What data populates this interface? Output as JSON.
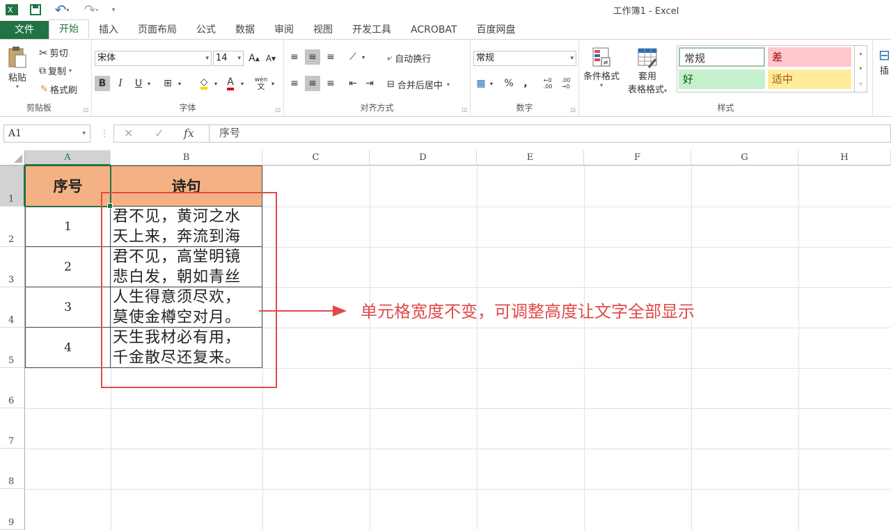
{
  "window": {
    "title": "工作簿1 - Excel"
  },
  "quick_access": {
    "undo": "↶",
    "redo": "↷"
  },
  "tabs": [
    "文件",
    "开始",
    "插入",
    "页面布局",
    "公式",
    "数据",
    "审阅",
    "视图",
    "开发工具",
    "ACROBAT",
    "百度网盘"
  ],
  "active_tab": "开始",
  "ribbon": {
    "clipboard": {
      "label": "剪贴板",
      "paste": "粘贴",
      "cut": "剪切",
      "copy": "复制",
      "format_painter": "格式刷"
    },
    "font": {
      "label": "字体",
      "name": "宋体",
      "size": "14",
      "bold": "B",
      "italic": "I",
      "underline": "U",
      "grow": "A",
      "shrink": "A",
      "phonetic": "wén"
    },
    "alignment": {
      "label": "对齐方式",
      "wrap_text": "自动换行",
      "merge_center": "合并后居中"
    },
    "number": {
      "label": "数字",
      "format": "常规",
      "percent": "%",
      "comma": ","
    },
    "styles": {
      "label": "样式",
      "conditional": "条件格式",
      "table_format_line1": "套用",
      "table_format_line2": "表格格式",
      "cells": [
        {
          "name": "常规",
          "bg": "#ffffff",
          "fg": "#333333"
        },
        {
          "name": "差",
          "bg": "#ffc7ce",
          "fg": "#9c0006"
        },
        {
          "name": "好",
          "bg": "#c6efce",
          "fg": "#006100"
        },
        {
          "name": "适中",
          "bg": "#ffeb9c",
          "fg": "#9c5700"
        }
      ]
    },
    "insert": "插"
  },
  "formula_bar": {
    "name_box": "A1",
    "cancel": "✕",
    "enter": "✓",
    "fx": "fx",
    "content": "序号"
  },
  "columns": [
    "A",
    "B",
    "C",
    "D",
    "E",
    "F",
    "G",
    "H"
  ],
  "rows": [
    "1",
    "2",
    "3",
    "4",
    "5",
    "6",
    "7",
    "8",
    "9"
  ],
  "sheet": {
    "header": {
      "a": "序号",
      "b": "诗句"
    },
    "data": [
      {
        "num": "1",
        "line1": "君不见，黄河之水",
        "line2": "天上来，奔流到海"
      },
      {
        "num": "2",
        "line1": "君不见，高堂明镜",
        "line2": "悲白发，朝如青丝"
      },
      {
        "num": "3",
        "line1": "人生得意须尽欢，",
        "line2": "莫使金樽空对月。"
      },
      {
        "num": "4",
        "line1": "天生我材必有用，",
        "line2": "千金散尽还复来。"
      }
    ]
  },
  "annotation": "单元格宽度不变，可调整高度让文字全部显示",
  "colors": {
    "excel_green": "#217346",
    "header_fill": "#f4b183",
    "annotation_red": "#e04a4a"
  }
}
